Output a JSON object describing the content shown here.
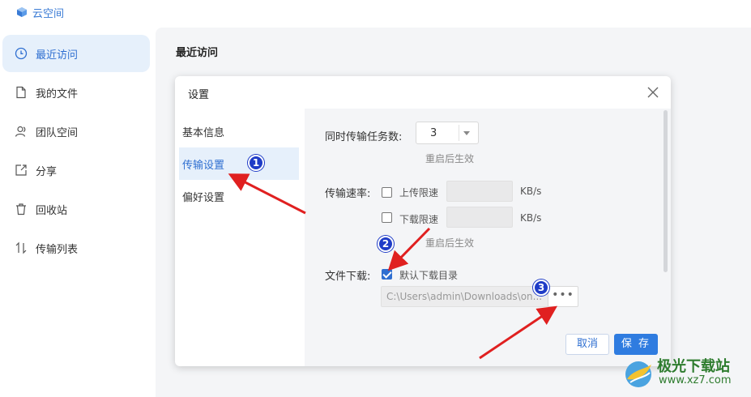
{
  "app": {
    "title": "云空间",
    "logo_icon": "cube-icon",
    "accent": "#2f6fd1"
  },
  "sidebar": {
    "items": [
      {
        "label": "最近访问",
        "icon": "clock-icon",
        "active": true
      },
      {
        "label": "我的文件",
        "icon": "file-icon",
        "active": false
      },
      {
        "label": "团队空间",
        "icon": "team-icon",
        "active": false
      },
      {
        "label": "分享",
        "icon": "share-icon",
        "active": false
      },
      {
        "label": "回收站",
        "icon": "trash-icon",
        "active": false
      },
      {
        "label": "传输列表",
        "icon": "transfer-icon",
        "active": false
      }
    ]
  },
  "main": {
    "title": "最近访问"
  },
  "dialog": {
    "title": "设置",
    "nav": [
      {
        "label": "基本信息",
        "active": false
      },
      {
        "label": "传输设置",
        "active": true
      },
      {
        "label": "偏好设置",
        "active": false
      }
    ],
    "concurrent": {
      "label": "同时传输任务数:",
      "value": "3",
      "hint": "重启后生效"
    },
    "speed": {
      "label": "传输速率:",
      "upload_label": "上传限速",
      "upload_checked": false,
      "upload_unit": "KB/s",
      "download_label": "下载限速",
      "download_checked": false,
      "download_unit": "KB/s",
      "hint": "重启后生效"
    },
    "download": {
      "label": "文件下载:",
      "default_dir_label": "默认下载目录",
      "default_dir_checked": true,
      "path": "C:\\Users\\admin\\Downloads\\on...",
      "browse_label": "•••"
    },
    "buttons": {
      "cancel": "取消",
      "save": "保 存"
    }
  },
  "annotations": {
    "markers": [
      "1",
      "2",
      "3"
    ],
    "marker_color": "#1f3cc7",
    "arrow_color": "#e02020"
  },
  "watermark": {
    "line1": "极光下载站",
    "line2": "www.xz7.com"
  }
}
